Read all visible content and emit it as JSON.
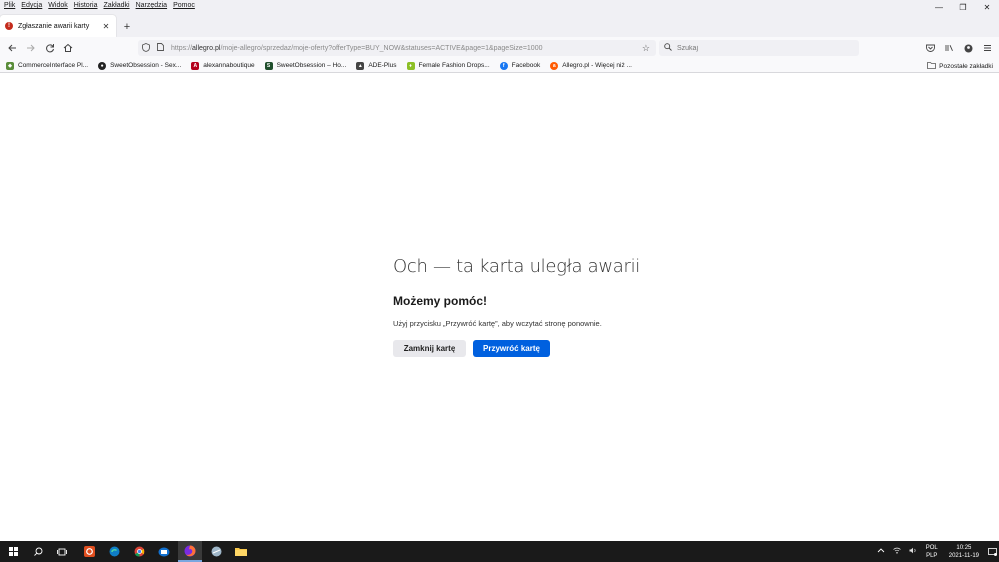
{
  "menubar": {
    "items": [
      "Plik",
      "Edycja",
      "Widok",
      "Historia",
      "Zakładki",
      "Narzędzia",
      "Pomoc"
    ]
  },
  "window_controls": {
    "minimize": "—",
    "maximize": "❐",
    "close": "✕"
  },
  "tab": {
    "icon": "!",
    "title": "Zgłaszanie awarii karty",
    "close": "✕",
    "new_tab": "+"
  },
  "navbar": {
    "url_prefix": "https://",
    "url_domain": "allegro.pl",
    "url_path": "/moje-allegro/sprzedaz/moje-oferty?offerType=BUY_NOW&statuses=ACTIVE&page=1&pageSize=1000",
    "search_placeholder": "Szukaj"
  },
  "bookmarks": {
    "items": [
      {
        "label": "CommerceInterface Pl...",
        "icon": "puzzle-icon",
        "color": "#5a8d3a"
      },
      {
        "label": "SweetObsession - Sex...",
        "icon": "github-icon",
        "color": "#222222"
      },
      {
        "label": "alexannaboutique",
        "icon": "a-icon",
        "color": "#b3001b"
      },
      {
        "label": "SweetObsession – Ho...",
        "icon": "s-icon",
        "color": "#1e4d2b"
      },
      {
        "label": "ADE-Plus",
        "icon": "leaf-icon",
        "color": "#444444"
      },
      {
        "label": "Female Fashion Drops...",
        "icon": "pin-icon",
        "color": "#8cbf26"
      },
      {
        "label": "Facebook",
        "icon": "facebook-icon",
        "color": "#1877f2"
      },
      {
        "label": "Allegro.pl - Więcej niż ...",
        "icon": "allegro-icon",
        "color": "#ff5a00"
      }
    ],
    "other": "Pozostałe zakładki"
  },
  "crash": {
    "title": "Och — ta karta uległa awarii",
    "heading": "Możemy pomóc!",
    "description": "Użyj przycisku „Przywróć kartę”, aby wczytać stronę ponownie.",
    "close_button": "Zamknij kartę",
    "restore_button": "Przywróć kartę"
  },
  "taskbar": {
    "lang_line1": "POL",
    "lang_line2": "PLP",
    "time": "10:25",
    "date": "2021-11-19"
  },
  "colors": {
    "accent": "#0060df",
    "tab_icon": "#c42b1c",
    "taskbar": "#1a1a1a"
  }
}
